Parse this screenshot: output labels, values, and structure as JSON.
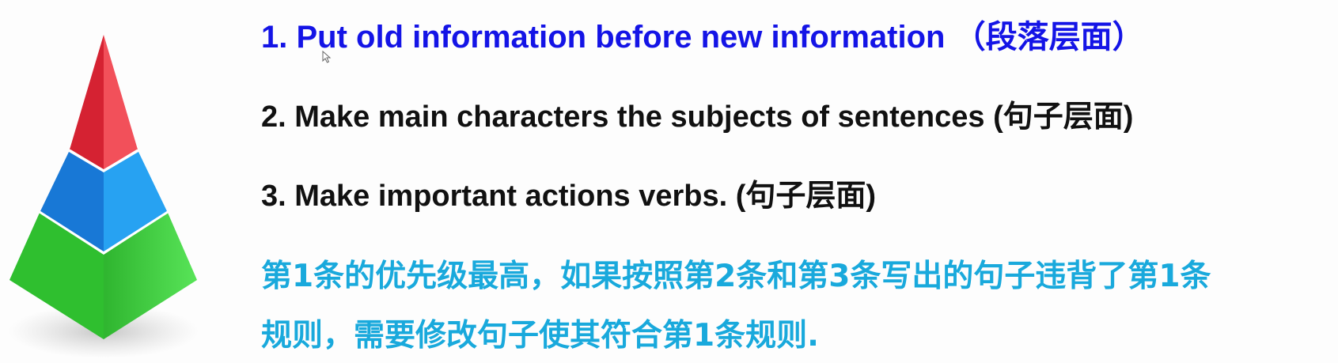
{
  "rules": {
    "rule1": "1.  Put old information before new information  （段落层面）",
    "rule2": "2. Make main characters the subjects of sentences  (句子层面)",
    "rule3": "3. Make important actions verbs.  (句子层面)"
  },
  "note": {
    "line1": "第1条的优先级最高，如果按照第2条和第3条写出的句子违背了第1条",
    "line2": "规则，需要修改句子使其符合第1条规则."
  },
  "colors": {
    "rule1": "#1414e6",
    "rules": "#111111",
    "note": "#19a9dc",
    "pyramid_top": "#e8323f",
    "pyramid_middle": "#1e8ee0",
    "pyramid_bottom": "#3ed13e"
  },
  "icons": {
    "pyramid": "pyramid-illustration",
    "cursor": "mouse-pointer-icon"
  }
}
